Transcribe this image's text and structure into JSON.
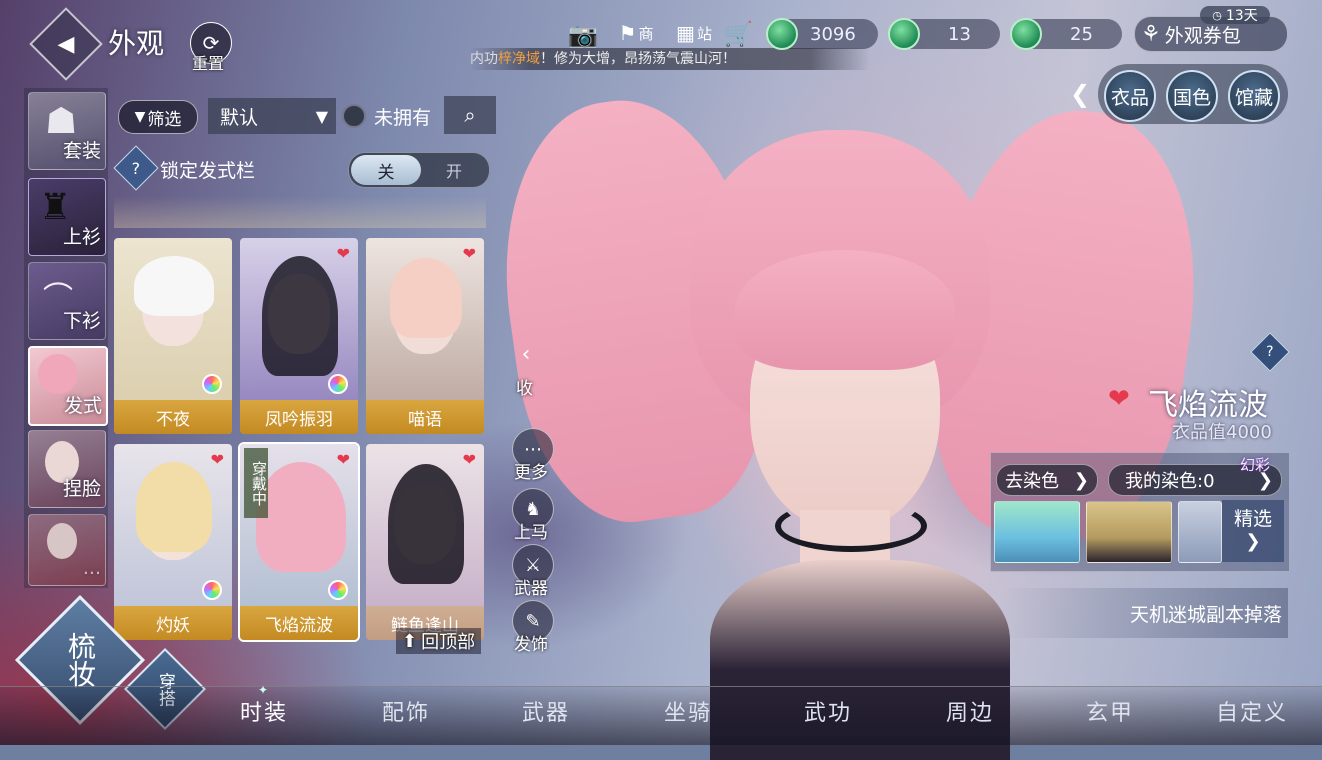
{
  "header": {
    "title": "外观",
    "reset_label": "重置",
    "shop_label": "商",
    "station_label": "站",
    "ticker_prefix": "内功",
    "ticker_highlight": "梓净域",
    "ticker_text": "！修为大增，昂扬荡气震山河！"
  },
  "currencies": [
    {
      "value": "3096"
    },
    {
      "value": "13"
    },
    {
      "value": "25"
    }
  ],
  "voucher": {
    "label": "外观券包",
    "days": "13天"
  },
  "right_tabs": [
    "衣品",
    "国色",
    "馆藏"
  ],
  "categories": [
    {
      "label": "套装"
    },
    {
      "label": "上衫"
    },
    {
      "label": "下衫"
    },
    {
      "label": "发式"
    },
    {
      "label": "捏脸"
    },
    {
      "label": "..."
    }
  ],
  "filter": {
    "filter_label": "筛选",
    "sort_value": "默认",
    "unowned_label": "未拥有"
  },
  "lock": {
    "label": "锁定发式栏",
    "off_label": "关",
    "on_label": "开"
  },
  "items": [
    {
      "name": "不夜",
      "wearing": false
    },
    {
      "name": "凤吟振羽",
      "wearing": false
    },
    {
      "name": "喵语",
      "wearing": false
    },
    {
      "name": "灼妖",
      "wearing": false
    },
    {
      "name": "飞焰流波",
      "wearing": true,
      "wearing_label": "穿戴中"
    },
    {
      "name": "鲢鱼逢山",
      "wearing": false
    }
  ],
  "back_to_top": "回顶部",
  "side_actions": {
    "collapse": "收",
    "more": "更多",
    "mount": "上马",
    "weapon": "武器",
    "accessory": "发饰"
  },
  "detail": {
    "name": "飞焰流波",
    "score": "衣品值4000",
    "dye_remove": "去染色",
    "my_dye": "我的染色:0",
    "illusion": "幻彩",
    "select_label": "精选",
    "source": "天机迷城副本掉落"
  },
  "mode": {
    "makeup": "梳妆",
    "outfit": "穿搭"
  },
  "bottom_nav": [
    "时装",
    "配饰",
    "武器",
    "坐骑",
    "武功",
    "周边",
    "玄甲",
    "自定义"
  ]
}
